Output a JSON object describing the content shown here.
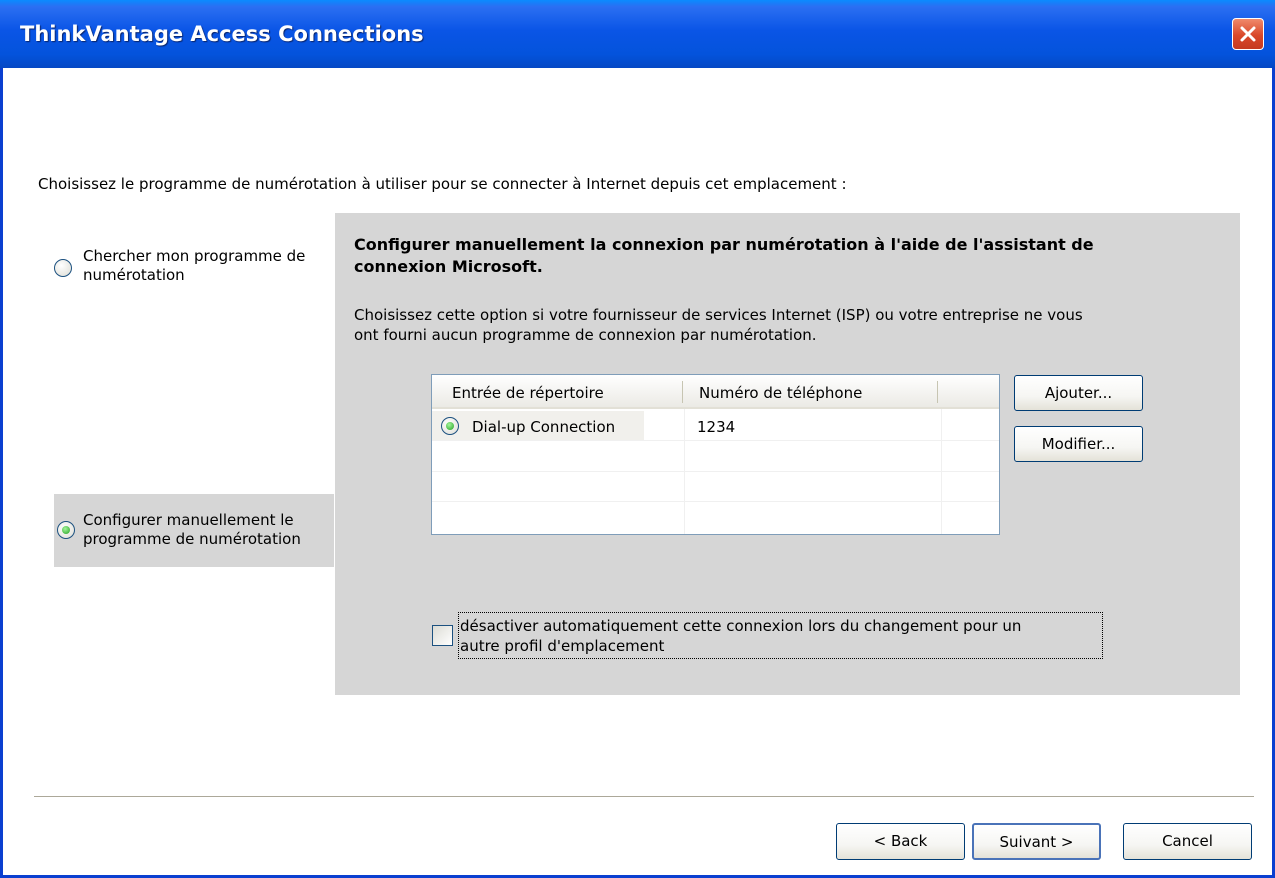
{
  "window": {
    "title": "ThinkVantage Access Connections"
  },
  "prompt": "Choisissez le programme de numérotation à utiliser pour se connecter à Internet depuis cet emplacement :",
  "options": {
    "find_program": {
      "label_line1": "Chercher mon programme de",
      "label_line2": "numérotation",
      "selected": false
    },
    "manual_config": {
      "label_line1": "Configurer manuellement le",
      "label_line2": "programme de numérotation",
      "selected": true
    }
  },
  "panel": {
    "heading_line1": "Configurer manuellement la connexion par numérotation à l'aide de l'assistant de",
    "heading_line2": "connexion Microsoft.",
    "desc_line1": "Choisissez cette option si votre fournisseur de services Internet (ISP) ou votre entreprise ne vous",
    "desc_line2": "ont fourni aucun programme de connexion par numérotation.",
    "table": {
      "columns": [
        "Entrée de répertoire",
        "Numéro de téléphone"
      ],
      "rows": [
        {
          "entry": "Dial-up Connection",
          "phone": "1234",
          "selected": true
        }
      ]
    },
    "add_button": "Ajouter...",
    "modify_button": "Modifier...",
    "checkbox": {
      "label_line1": "désactiver automatiquement cette connexion lors du changement pour un",
      "label_line2": "autre profil d'emplacement",
      "checked": false
    }
  },
  "footer": {
    "back": "< Back",
    "next": "Suivant >",
    "cancel": "Cancel"
  }
}
